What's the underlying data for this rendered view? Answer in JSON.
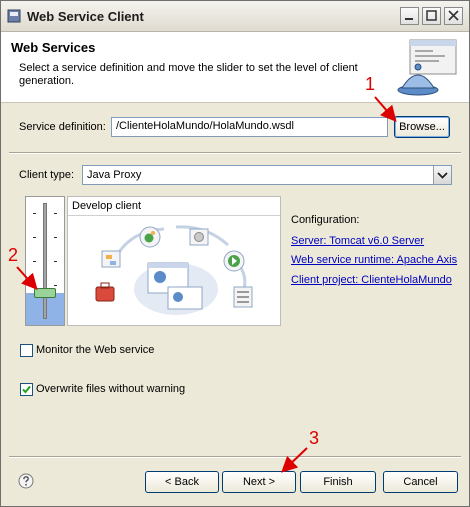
{
  "window": {
    "title": "Web Service Client"
  },
  "header": {
    "title": "Web Services",
    "description": "Select a service definition and move the slider to set the level of client generation."
  },
  "service_definition": {
    "label": "Service definition:",
    "value": "/ClienteHolaMundo/HolaMundo.wsdl",
    "browse_label": "Browse..."
  },
  "client_type": {
    "label": "Client type:",
    "value": "Java Proxy"
  },
  "slider": {
    "level": "Develop client",
    "level_fraction": 0.25
  },
  "configuration": {
    "label": "Configuration:",
    "server": "Server: Tomcat v6.0 Server",
    "runtime": "Web service runtime: Apache Axis",
    "project": "Client project: ClienteHolaMundo"
  },
  "options": {
    "monitor_label": "Monitor the Web service",
    "monitor_checked": false,
    "overwrite_label": "Overwrite files without warning",
    "overwrite_checked": true
  },
  "buttons": {
    "back": "< Back",
    "next": "Next >",
    "finish": "Finish",
    "cancel": "Cancel"
  },
  "annotations": [
    "1",
    "2",
    "3"
  ],
  "colors": {
    "annotation": "#dd0000",
    "link": "#0000c0",
    "slider_fill": "#8fb3e6"
  }
}
